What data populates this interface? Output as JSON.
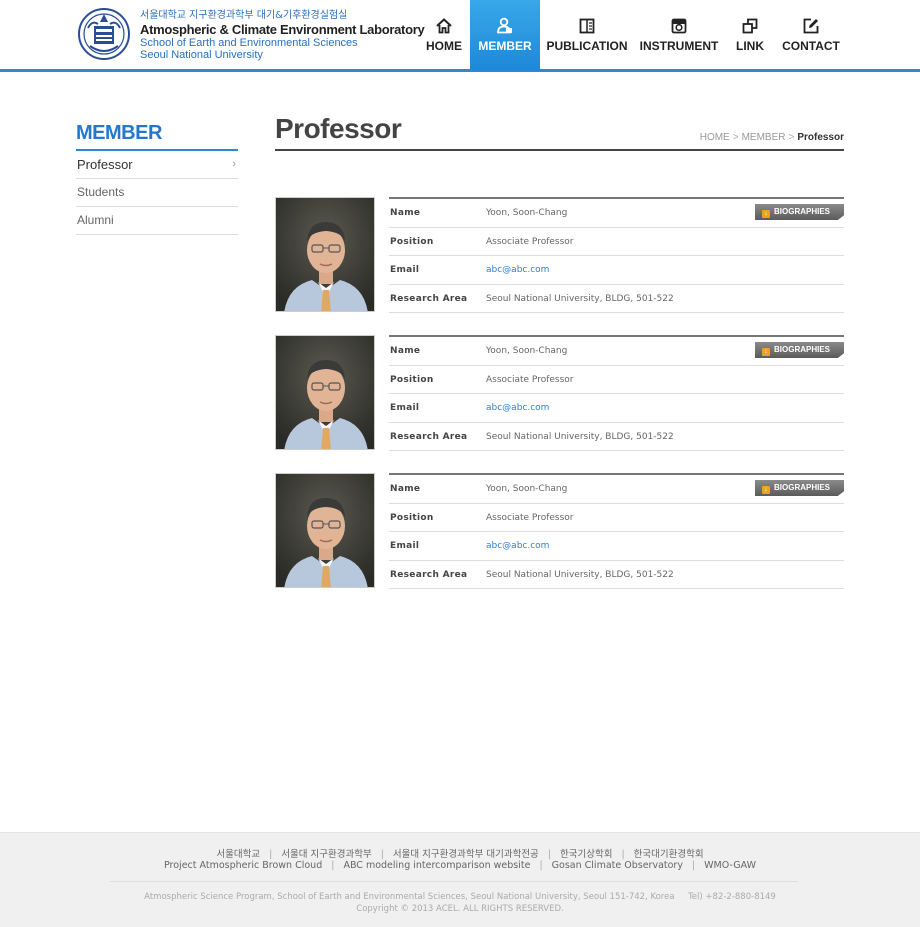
{
  "header": {
    "logo_kr": "서울대학교 지구환경과학부 대기&기후환경실험실",
    "logo_en": "Atmospheric & Climate Environment Laboratory",
    "logo_sub1": "School of Earth and Environmental Sciences",
    "logo_sub2": "Seoul National University",
    "accent_color": "#2b87d8"
  },
  "nav": {
    "items": [
      {
        "label": "HOME",
        "icon": "home-icon"
      },
      {
        "label": "MEMBER",
        "icon": "member-icon",
        "active": true
      },
      {
        "label": "PUBLICATION",
        "icon": "book-icon"
      },
      {
        "label": "INSTRUMENT",
        "icon": "camera-icon"
      },
      {
        "label": "LINK",
        "icon": "link-icon"
      },
      {
        "label": "CONTACT",
        "icon": "edit-icon"
      }
    ]
  },
  "sidebar": {
    "title": "MEMBER",
    "items": [
      {
        "label": "Professor",
        "active": true
      },
      {
        "label": "Students"
      },
      {
        "label": "Alumni"
      }
    ]
  },
  "page": {
    "title": "Professor",
    "breadcrumb": [
      "HOME",
      "MEMBER",
      "Professor"
    ]
  },
  "members": [
    {
      "name": "Yoon, Soon-Chang",
      "position": "Associate Professor",
      "email": "abc@abc.com",
      "research_area": "Seoul National University, BLDG, 501-522"
    },
    {
      "name": "Yoon, Soon-Chang",
      "position": "Associate Professor",
      "email": "abc@abc.com",
      "research_area": "Seoul National University, BLDG, 501-522"
    },
    {
      "name": "Yoon, Soon-Chang",
      "position": "Associate Professor",
      "email": "abc@abc.com",
      "research_area": "Seoul National University, BLDG, 501-522"
    }
  ],
  "labels": {
    "name": "Name",
    "position": "Position",
    "email": "Email",
    "research_area": "Research Area",
    "bio_button": "BIOGRAPHIES"
  },
  "footer": {
    "links_row1": [
      "서울대학교",
      "서울대 지구환경과학부",
      "서울대 지구환경과학부 대기과학전공",
      "한국기상학회",
      "한국대기환경학회"
    ],
    "links_row2": [
      "Project Atmospheric Brown Cloud",
      "ABC modeling intercomparison website",
      "Gosan Climate Observatory",
      "WMO-GAW"
    ],
    "address": "Atmospheric Science Program, School of Earth and Environmental Sciences, Seoul National University, Seoul 151-742, Korea",
    "tel": "Tel) +82-2-880-8149",
    "copyright": "Copyright © 2013 ACEL. ALL RIGHTS RESERVED."
  }
}
